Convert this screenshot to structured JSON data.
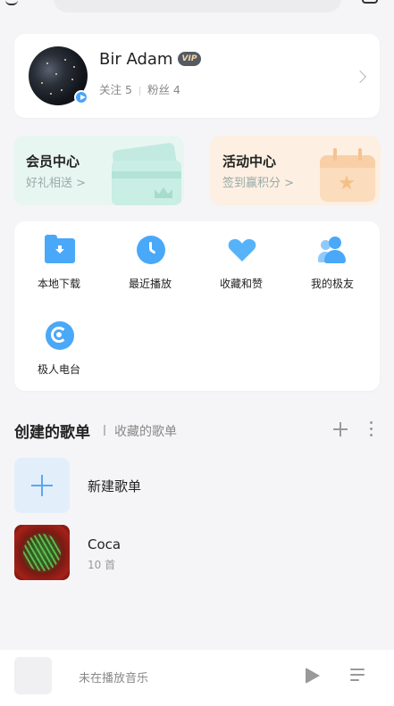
{
  "profile": {
    "name": "Bir Adam",
    "vip_badge": "VIP",
    "following": "关注 5",
    "fans": "粉丝 4"
  },
  "centers": [
    {
      "title": "会员中心",
      "subtitle": "好礼相送 >"
    },
    {
      "title": "活动中心",
      "subtitle": "签到赢积分 >"
    }
  ],
  "shortcuts": [
    {
      "label": "本地下载",
      "icon": "download-folder-icon"
    },
    {
      "label": "最近播放",
      "icon": "clock-icon"
    },
    {
      "label": "收藏和赞",
      "icon": "heart-icon"
    },
    {
      "label": "我的极友",
      "icon": "friends-icon"
    },
    {
      "label": "极人电台",
      "icon": "radio-icon"
    }
  ],
  "playlist_tabs": {
    "created": "创建的歌单",
    "favorites": "收藏的歌单"
  },
  "playlists": [
    {
      "title": "新建歌单"
    },
    {
      "title": "Coca",
      "count": "10 首"
    }
  ],
  "player": {
    "status": "未在播放音乐"
  },
  "colors": {
    "accent": "#4aa8f8",
    "member_card": "#e8f6f2",
    "activity_card": "#fdefe1",
    "vip_badge": "#555a63"
  }
}
